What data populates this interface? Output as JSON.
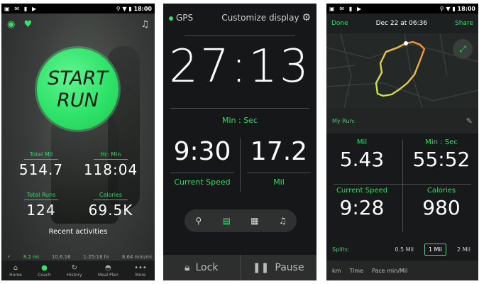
{
  "colors": {
    "accent": "#33e36b",
    "accent_text": "#38d66d"
  },
  "status_bar": {
    "time": "18:00"
  },
  "screen1": {
    "start_line1": "START",
    "start_line2": "RUN",
    "stats": [
      {
        "label": "Total Mil",
        "value": "514.7"
      },
      {
        "label": "Hr: Min",
        "value": "118:04"
      },
      {
        "label": "Total Runs",
        "value": "124"
      },
      {
        "label": "Calories",
        "value": "69.5K"
      }
    ],
    "recent_title": "Recent activities",
    "recent_row": [
      "8.2 mi",
      "10.6.16",
      "1:25:18 hr",
      "8.64 min/mi"
    ],
    "nav": [
      {
        "label": "Home",
        "icon": "home-icon"
      },
      {
        "label": "Coach",
        "icon": "coach-icon"
      },
      {
        "label": "History",
        "icon": "history-icon"
      },
      {
        "label": "Meal Plan",
        "icon": "meal-plan-icon"
      },
      {
        "label": "More",
        "icon": "more-icon"
      }
    ]
  },
  "screen2": {
    "gps_label": "GPS",
    "customize_label": "Customize display",
    "main_time": "27:13",
    "main_unit": "Min : Sec",
    "speed_value": "9:30",
    "speed_label": "Current Speed",
    "distance_value": "17.2",
    "distance_label": "Mil",
    "lock_label": "Lock",
    "pause_label": "Pause"
  },
  "screen3": {
    "done_label": "Done",
    "date_title": "Dec 22 at 06:36",
    "share_label": "Share",
    "my_run_label": "My Run:",
    "stats": [
      {
        "label": "Mil",
        "value": "5.43"
      },
      {
        "label": "Min : Sec",
        "value": "55:52"
      },
      {
        "label": "Current Speed",
        "value": "9:28"
      },
      {
        "label": "Calories",
        "value": "980"
      }
    ],
    "splits_label": "Splits:",
    "split_options": [
      "0.5 Mil",
      "1 Mil",
      "2 Mil"
    ],
    "selected_split": "1 Mil",
    "columns": [
      "km",
      "Time",
      "Pace min/Mil"
    ]
  }
}
